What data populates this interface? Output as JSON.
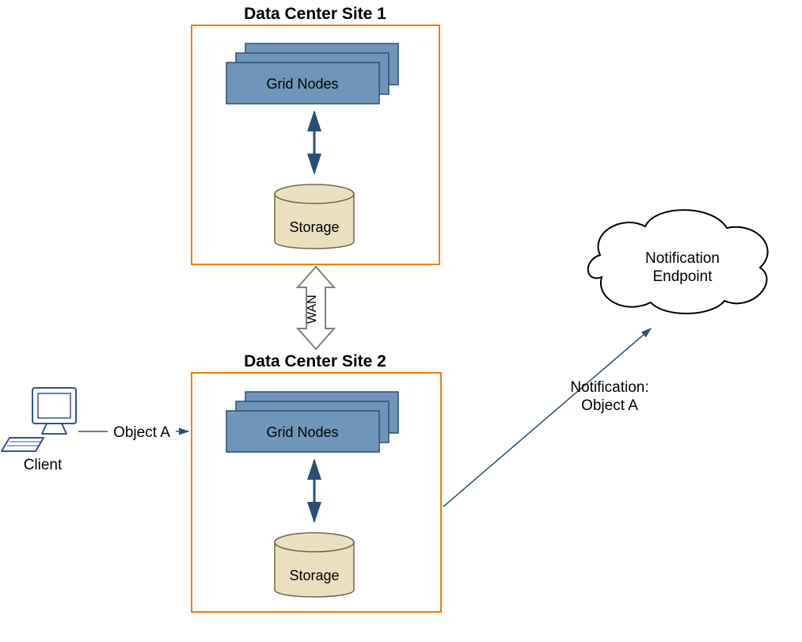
{
  "site1": {
    "title": "Data Center Site 1",
    "grid_label": "Grid Nodes",
    "storage_label": "Storage"
  },
  "site2": {
    "title": "Data Center Site 2",
    "grid_label": "Grid Nodes",
    "storage_label": "Storage"
  },
  "wan_label": "WAN",
  "client": {
    "label": "Client",
    "object_label": "Object A"
  },
  "notification": {
    "arrow_label_line1": "Notification:",
    "arrow_label_line2": "Object A",
    "cloud_label_line1": "Notification",
    "cloud_label_line2": "Endpoint"
  },
  "colors": {
    "site_border": "#EF7D00",
    "node_fill": "#6F96B9",
    "node_stroke": "#294F77",
    "storage_fill": "#EAE0C0",
    "storage_stroke": "#6E664C",
    "arrow_blue": "#294F77",
    "wan_stroke": "#808080",
    "wan_fill": "#FFFFFF",
    "client_fill": "#FFFFFF",
    "client_stroke": "#2F5597"
  }
}
